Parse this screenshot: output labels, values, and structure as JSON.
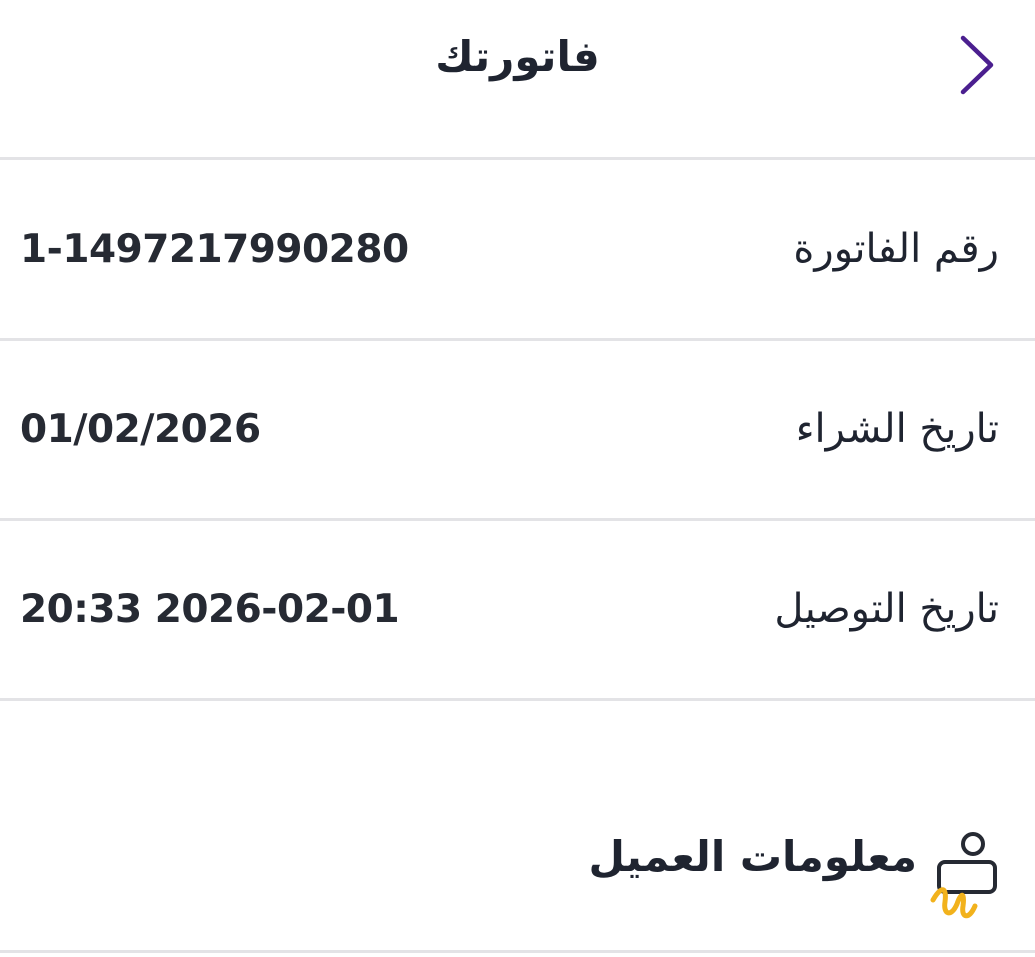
{
  "header": {
    "title": "فاتورتك",
    "back_icon": "chevron-right-icon",
    "accent_color": "#4b1f8f"
  },
  "details": [
    {
      "label": "رقم الفاتورة",
      "value": "1-1497217990280"
    },
    {
      "label": "تاريخ الشراء",
      "value": "01/02/2026"
    },
    {
      "label": "تاريخ التوصيل",
      "value": "20:33 2026-02-01"
    }
  ],
  "customer_section": {
    "title": "معلومات العميل",
    "icon": "customer-id-card-icon"
  }
}
